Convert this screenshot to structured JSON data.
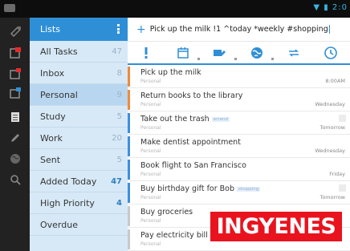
{
  "statusbar": {
    "right_text": "▼ ▮ 2:0"
  },
  "rail": {
    "icons": [
      "tag-icon",
      "calendar-red-icon",
      "calendar-icon",
      "calendar-blue-icon",
      "list-icon",
      "pencil-icon",
      "globe-icon",
      "search-icon"
    ]
  },
  "lists": {
    "header": "Lists",
    "items": [
      {
        "label": "All Tasks",
        "count": "47"
      },
      {
        "label": "Inbox",
        "count": "8"
      },
      {
        "label": "Personal",
        "count": "9"
      },
      {
        "label": "Study",
        "count": "5"
      },
      {
        "label": "Work",
        "count": "20"
      },
      {
        "label": "Sent",
        "count": "5"
      },
      {
        "label": "Added Today",
        "count": "47"
      },
      {
        "label": "High Priority",
        "count": "4"
      },
      {
        "label": "Overdue",
        "count": ""
      }
    ]
  },
  "addbar": {
    "plus": "+",
    "text": "Pick up the milk !1 ^today *weekly #shopping"
  },
  "tasks": [
    {
      "title": "Pick up the milk",
      "list": "Personal",
      "tag": "",
      "date": "8:00AM",
      "color": "#f08a3c",
      "note": false
    },
    {
      "title": "Return books to the library",
      "list": "Personal",
      "tag": "",
      "date": "Wednesday",
      "color": "#f08a3c",
      "note": false
    },
    {
      "title": "Take out the trash",
      "list": "Personal",
      "tag": "errand",
      "date": "Tomorrow",
      "color": "#3d8fe0",
      "note": true
    },
    {
      "title": "Make dentist appointment",
      "list": "Personal",
      "tag": "",
      "date": "Wednesday",
      "color": "#3d8fe0",
      "note": false
    },
    {
      "title": "Book flight to San Francisco",
      "list": "Personal",
      "tag": "",
      "date": "Friday",
      "color": "#3d8fe0",
      "note": false
    },
    {
      "title": "Buy birthday gift for Bob",
      "list": "Personal",
      "tag": "shopping",
      "date": "Tomorrow",
      "color": "#3d8fe0",
      "note": true
    },
    {
      "title": "Buy groceries",
      "list": "Personal",
      "tag": "",
      "date": "",
      "color": "#c9c9c9",
      "note": false
    },
    {
      "title": "Pay electricity bill",
      "list": "Personal",
      "tag": "",
      "date": "",
      "color": "#c9c9c9",
      "note": false
    }
  ],
  "banner": {
    "text": "INGYENES"
  },
  "colors": {
    "accent": "#2f8fd6",
    "priority_red": "#e42b2b",
    "list_bg": "#d7e9f7",
    "banner": "#e9131e"
  }
}
